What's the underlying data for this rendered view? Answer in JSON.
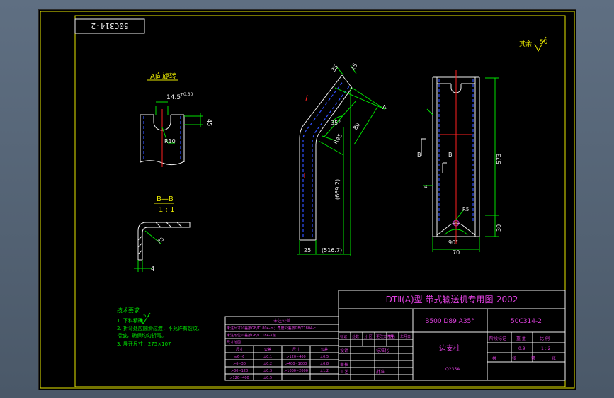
{
  "drawing": {
    "stamp_code": "50C314-2",
    "roughness_label": "其余",
    "roughness_value": "50",
    "view_a_title": "A向旋转",
    "section_title": "B—B",
    "section_scale": "1 : 1",
    "dims": {
      "width_145": "14.5",
      "tol_145": "+0.30",
      "dim_45": "45",
      "radius_r10": "R10",
      "thick_4": "4",
      "r5_left": "R5",
      "dim_35": "35",
      "dim_15": "15",
      "angle_35": "35°",
      "dim_80": "80",
      "r45": "R45",
      "len_6692": "(669.2)",
      "dim_25": "25",
      "dim_5167": "(516.7)",
      "letter_a": "A",
      "dim_573": "573",
      "dim_30": "30",
      "dim_70": "70",
      "angle_90": "90°",
      "r5_right": "R5",
      "letter_b1": "B",
      "letter_b2": "B",
      "dim_4_right": "4"
    },
    "notes": {
      "title": "技术要求",
      "line1": "1. 下料精确",
      "line1_mark": "50",
      "line2": "2. 折弯处应圆滑过渡，不允许有裂纹、",
      "line2b": "   褶皱，确保均匀折弯。",
      "line3": "3. 展开尺寸：275×107"
    }
  },
  "title_block": {
    "main_title": "DTⅡ(A)型  带式输送机专用图-2002",
    "spec": "B500 D89 A35°",
    "code": "50C314-2",
    "part_name": "边支柱",
    "material": "Q235A",
    "grid_small": [
      "标记",
      "处数",
      "分 区",
      "更改文件号",
      "签名",
      "年月日"
    ],
    "design": "设计",
    "std": "标准化",
    "check": "审核",
    "process": "工艺",
    "approve": "批准",
    "stage": "阶段标记",
    "weight": "重 量",
    "scale": "比 例",
    "weight_val": "0.9",
    "scale_val": "1 : 2",
    "sheet1": "共",
    "sheet2": "张",
    "sheet3": "第",
    "sheet4": "张"
  },
  "tolerance_table": {
    "title": "未注公差",
    "note1": "未注尺寸公差按GB/T1804-m；角度公差按GB/T1804-c",
    "note2": "未注形位公差按GB/T1184-K级",
    "col_label": "尺寸范围",
    "headers": [
      "尺寸",
      "公差",
      "尺寸",
      "公差"
    ],
    "rows": [
      [
        "≤6~6",
        "±0.1",
        ">120~400",
        "±0.5"
      ],
      [
        ">6~30",
        "±0.2",
        ">400~1000",
        "±0.8"
      ],
      [
        ">30~120",
        "±0.3",
        ">1000~2000",
        "±1.2"
      ],
      [
        ">120~400",
        "±0.5",
        "",
        ""
      ]
    ]
  }
}
